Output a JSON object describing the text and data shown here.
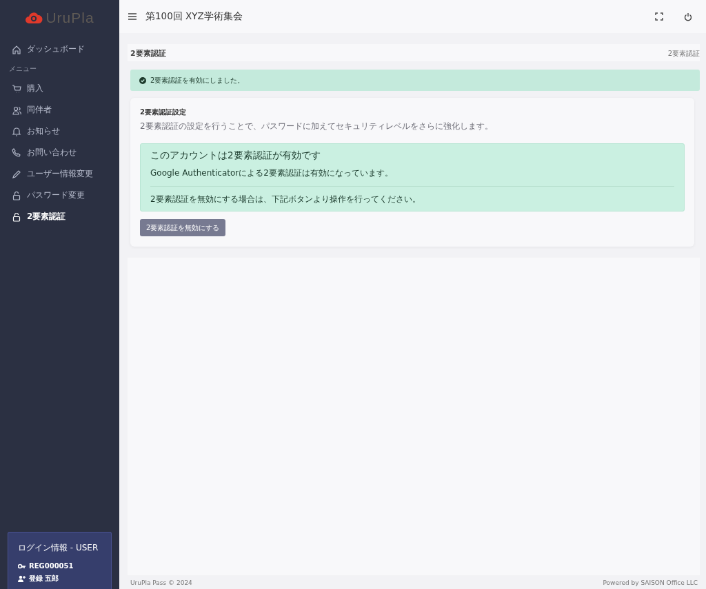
{
  "sidebar": {
    "logo": "UruPla",
    "items": [
      {
        "kind": "link",
        "label": "ダッシュボード",
        "selected": false
      },
      {
        "kind": "heading",
        "label": "メニュー"
      },
      {
        "kind": "link",
        "label": "購入",
        "selected": false
      },
      {
        "kind": "link",
        "label": "同伴者",
        "selected": false
      },
      {
        "kind": "link",
        "label": "お知らせ",
        "selected": false
      },
      {
        "kind": "link",
        "label": "お問い合わせ",
        "selected": false
      },
      {
        "kind": "link",
        "label": "ユーザー情報変更",
        "selected": false
      },
      {
        "kind": "link",
        "label": "パスワード変更",
        "selected": false
      },
      {
        "kind": "link",
        "label": "2要素認証",
        "selected": true
      }
    ],
    "login": {
      "title": "ログイン情報 - USER",
      "id": "REG000051",
      "user": "登録 五郎"
    }
  },
  "header": {
    "title": "第100回 XYZ学術集会"
  },
  "page": {
    "title": "2要素認証",
    "breadcrumb": "2要素認証"
  },
  "alert": {
    "message": "2要素認証を有効にしました。"
  },
  "card": {
    "title": "2要素認証設定",
    "description": "2要素認証の設定を行うことで、パスワードに加えてセキュリティレベルをさらに強化します。",
    "status": {
      "heading": "このアカウントは2要素認証が有効です",
      "detail": "Google Authenticatorによる2要素認証は有効になっています。",
      "note": "2要素認証を無効にする場合は、下記ボタンより操作を行ってください。"
    },
    "button": "2要素認証を無効にする"
  },
  "footer": {
    "left": "UruPla Pass © 2024",
    "right": "Powered by SAISON Office LLC"
  }
}
